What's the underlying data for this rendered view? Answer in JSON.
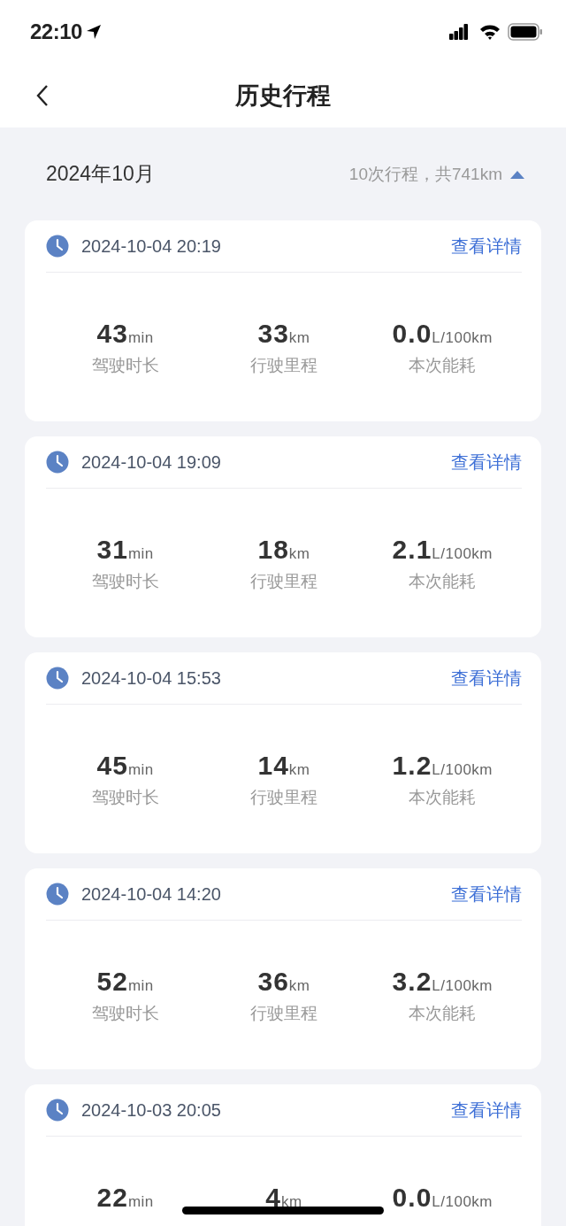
{
  "status_bar": {
    "time": "22:10"
  },
  "nav": {
    "title": "历史行程"
  },
  "month": {
    "label": "2024年10月",
    "summary": "10次行程，共741km",
    "expanded": true
  },
  "trips": [
    {
      "datetime": "2024-10-04 20:19",
      "link": "查看详情",
      "stats": [
        {
          "value": "43",
          "unit": "min",
          "label": "驾驶时长"
        },
        {
          "value": "33",
          "unit": "km",
          "label": "行驶里程"
        },
        {
          "value": "0.0",
          "unit": "L/100km",
          "label": "本次能耗"
        }
      ]
    },
    {
      "datetime": "2024-10-04 19:09",
      "link": "查看详情",
      "stats": [
        {
          "value": "31",
          "unit": "min",
          "label": "驾驶时长"
        },
        {
          "value": "18",
          "unit": "km",
          "label": "行驶里程"
        },
        {
          "value": "2.1",
          "unit": "L/100km",
          "label": "本次能耗"
        }
      ]
    },
    {
      "datetime": "2024-10-04 15:53",
      "link": "查看详情",
      "stats": [
        {
          "value": "45",
          "unit": "min",
          "label": "驾驶时长"
        },
        {
          "value": "14",
          "unit": "km",
          "label": "行驶里程"
        },
        {
          "value": "1.2",
          "unit": "L/100km",
          "label": "本次能耗"
        }
      ]
    },
    {
      "datetime": "2024-10-04 14:20",
      "link": "查看详情",
      "stats": [
        {
          "value": "52",
          "unit": "min",
          "label": "驾驶时长"
        },
        {
          "value": "36",
          "unit": "km",
          "label": "行驶里程"
        },
        {
          "value": "3.2",
          "unit": "L/100km",
          "label": "本次能耗"
        }
      ]
    },
    {
      "datetime": "2024-10-03 20:05",
      "link": "查看详情",
      "stats": [
        {
          "value": "22",
          "unit": "min"
        },
        {
          "value": "4",
          "unit": "km"
        },
        {
          "value": "0.0",
          "unit": "L/100km"
        }
      ]
    }
  ]
}
